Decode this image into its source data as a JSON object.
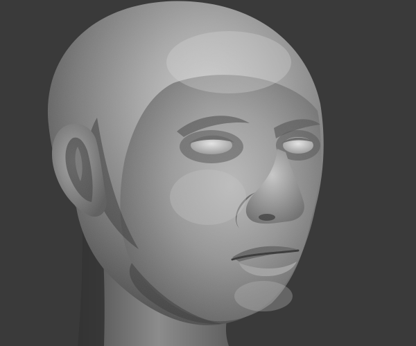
{
  "scene": {
    "subject": "sculpted-head",
    "material": "clay",
    "colors": {
      "background": "#3a3a3a",
      "clay_light": "#c4c4c4",
      "clay_mid": "#8e8e8e",
      "clay_dark": "#4a4a4a",
      "shadow": "#2a2a2a"
    }
  }
}
